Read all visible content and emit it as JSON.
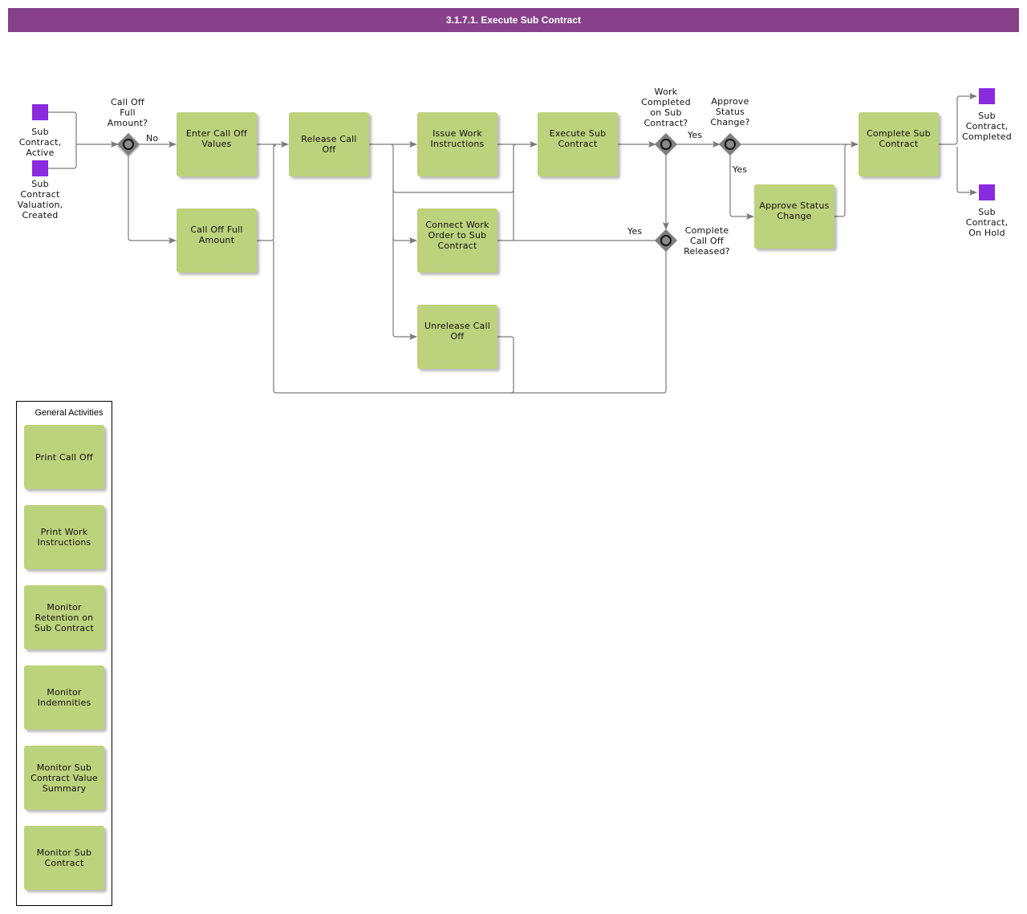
{
  "title": "3.1.7.1. Execute Sub Contract",
  "colors": {
    "title_bar": "#86418a",
    "task_fill": "#bdd27c",
    "event_fill": "#8a2be2",
    "gateway_fill": "#7f7f7f",
    "connector": "#7a7a7a"
  },
  "events": {
    "start_active": "Sub\nContract,\nActive",
    "start_valuation": "Sub\nContract\nValuation,\nCreated",
    "end_completed": "Sub\nContract,\nCompleted",
    "end_on_hold": "Sub\nContract,\nOn Hold"
  },
  "gateways": {
    "call_off_full_amount": "Call Off\nFull\nAmount?",
    "work_completed": "Work\nCompleted\non Sub\nContract?",
    "approve_status_change": "Approve\nStatus\nChange?",
    "complete_call_off_released": "Complete\nCall Off\nReleased?"
  },
  "flow_labels": {
    "no": "No",
    "yes_work_completed": "Yes",
    "yes_approve_status": "Yes",
    "yes_call_off_released": "Yes"
  },
  "tasks": {
    "enter_call_off_values": "Enter Call Off Values",
    "call_off_full_amount": "Call Off Full Amount",
    "release_call_off": "Release Call Off",
    "issue_work_instructions": "Issue Work Instructions",
    "connect_work_order": "Connect Work Order to Sub Contract",
    "unrelease_call_off": "Unrelease Call Off",
    "execute_sub_contract": "Execute Sub Contract",
    "approve_status_change": "Approve Status Change",
    "complete_sub_contract": "Complete Sub Contract"
  },
  "general_activities": {
    "title": "General Activities",
    "items": [
      "Print Call Off",
      "Print Work Instructions",
      "Monitor Retention on Sub Contract",
      "Monitor Indemnities",
      "Monitor Sub Contract Value Summary",
      "Monitor Sub Contract"
    ]
  }
}
